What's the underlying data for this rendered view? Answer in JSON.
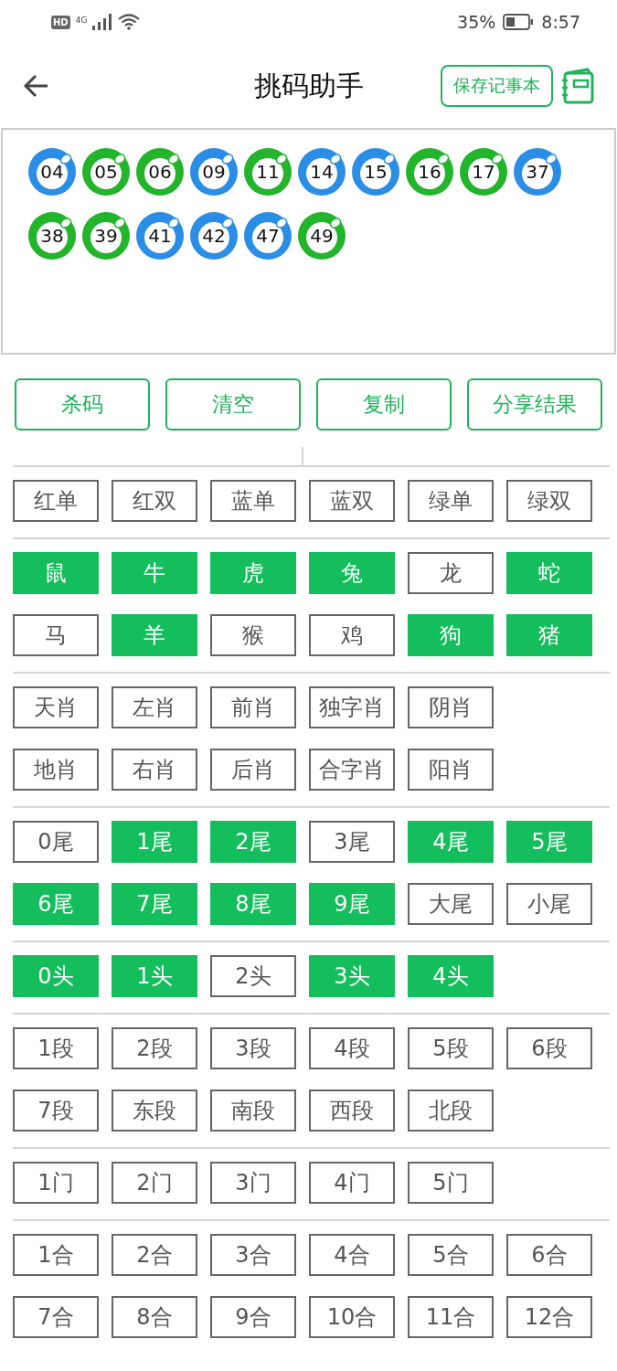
{
  "status_bar": {
    "hd": "HD",
    "network": "4G",
    "battery": "35%",
    "time": "8:57"
  },
  "header": {
    "title": "挑码助手",
    "save_button": "保存记事本"
  },
  "balls": [
    {
      "number": "04",
      "color": "#2a8de6"
    },
    {
      "number": "05",
      "color": "#22b42a"
    },
    {
      "number": "06",
      "color": "#22b42a"
    },
    {
      "number": "09",
      "color": "#2a8de6"
    },
    {
      "number": "11",
      "color": "#22b42a"
    },
    {
      "number": "14",
      "color": "#2a8de6"
    },
    {
      "number": "15",
      "color": "#2a8de6"
    },
    {
      "number": "16",
      "color": "#22b42a"
    },
    {
      "number": "17",
      "color": "#22b42a"
    },
    {
      "number": "37",
      "color": "#2a8de6"
    },
    {
      "number": "38",
      "color": "#22b42a"
    },
    {
      "number": "39",
      "color": "#22b42a"
    },
    {
      "number": "41",
      "color": "#2a8de6"
    },
    {
      "number": "42",
      "color": "#2a8de6"
    },
    {
      "number": "47",
      "color": "#2a8de6"
    },
    {
      "number": "49",
      "color": "#22b42a"
    }
  ],
  "actions": [
    "杀码",
    "清空",
    "复制",
    "分享结果"
  ],
  "groups": [
    {
      "rows": [
        [
          {
            "label": "红单",
            "selected": false
          },
          {
            "label": "红双",
            "selected": false
          },
          {
            "label": "蓝单",
            "selected": false
          },
          {
            "label": "蓝双",
            "selected": false
          },
          {
            "label": "绿单",
            "selected": false
          },
          {
            "label": "绿双",
            "selected": false
          }
        ]
      ]
    },
    {
      "rows": [
        [
          {
            "label": "鼠",
            "selected": true
          },
          {
            "label": "牛",
            "selected": true
          },
          {
            "label": "虎",
            "selected": true
          },
          {
            "label": "兔",
            "selected": true
          },
          {
            "label": "龙",
            "selected": false
          },
          {
            "label": "蛇",
            "selected": true
          }
        ],
        [
          {
            "label": "马",
            "selected": false
          },
          {
            "label": "羊",
            "selected": true
          },
          {
            "label": "猴",
            "selected": false
          },
          {
            "label": "鸡",
            "selected": false
          },
          {
            "label": "狗",
            "selected": true
          },
          {
            "label": "猪",
            "selected": true
          }
        ]
      ]
    },
    {
      "rows": [
        [
          {
            "label": "天肖",
            "selected": false
          },
          {
            "label": "左肖",
            "selected": false
          },
          {
            "label": "前肖",
            "selected": false
          },
          {
            "label": "独字肖",
            "selected": false
          },
          {
            "label": "阴肖",
            "selected": false
          }
        ],
        [
          {
            "label": "地肖",
            "selected": false
          },
          {
            "label": "右肖",
            "selected": false
          },
          {
            "label": "后肖",
            "selected": false
          },
          {
            "label": "合字肖",
            "selected": false
          },
          {
            "label": "阳肖",
            "selected": false
          }
        ]
      ]
    },
    {
      "rows": [
        [
          {
            "label": "0尾",
            "selected": false
          },
          {
            "label": "1尾",
            "selected": true
          },
          {
            "label": "2尾",
            "selected": true
          },
          {
            "label": "3尾",
            "selected": false
          },
          {
            "label": "4尾",
            "selected": true
          },
          {
            "label": "5尾",
            "selected": true
          }
        ],
        [
          {
            "label": "6尾",
            "selected": true
          },
          {
            "label": "7尾",
            "selected": true
          },
          {
            "label": "8尾",
            "selected": true
          },
          {
            "label": "9尾",
            "selected": true
          },
          {
            "label": "大尾",
            "selected": false
          },
          {
            "label": "小尾",
            "selected": false
          }
        ]
      ]
    },
    {
      "rows": [
        [
          {
            "label": "0头",
            "selected": true
          },
          {
            "label": "1头",
            "selected": true
          },
          {
            "label": "2头",
            "selected": false
          },
          {
            "label": "3头",
            "selected": true
          },
          {
            "label": "4头",
            "selected": true
          }
        ]
      ]
    },
    {
      "rows": [
        [
          {
            "label": "1段",
            "selected": false
          },
          {
            "label": "2段",
            "selected": false
          },
          {
            "label": "3段",
            "selected": false
          },
          {
            "label": "4段",
            "selected": false
          },
          {
            "label": "5段",
            "selected": false
          },
          {
            "label": "6段",
            "selected": false
          }
        ],
        [
          {
            "label": "7段",
            "selected": false
          },
          {
            "label": "东段",
            "selected": false
          },
          {
            "label": "南段",
            "selected": false
          },
          {
            "label": "西段",
            "selected": false
          },
          {
            "label": "北段",
            "selected": false
          }
        ]
      ]
    },
    {
      "rows": [
        [
          {
            "label": "1门",
            "selected": false
          },
          {
            "label": "2门",
            "selected": false
          },
          {
            "label": "3门",
            "selected": false
          },
          {
            "label": "4门",
            "selected": false
          },
          {
            "label": "5门",
            "selected": false
          }
        ]
      ]
    },
    {
      "rows": [
        [
          {
            "label": "1合",
            "selected": false
          },
          {
            "label": "2合",
            "selected": false
          },
          {
            "label": "3合",
            "selected": false
          },
          {
            "label": "4合",
            "selected": false
          },
          {
            "label": "5合",
            "selected": false
          },
          {
            "label": "6合",
            "selected": false
          }
        ],
        [
          {
            "label": "7合",
            "selected": false
          },
          {
            "label": "8合",
            "selected": false
          },
          {
            "label": "9合",
            "selected": false
          },
          {
            "label": "10合",
            "selected": false
          },
          {
            "label": "11合",
            "selected": false
          },
          {
            "label": "12合",
            "selected": false
          }
        ]
      ]
    }
  ]
}
